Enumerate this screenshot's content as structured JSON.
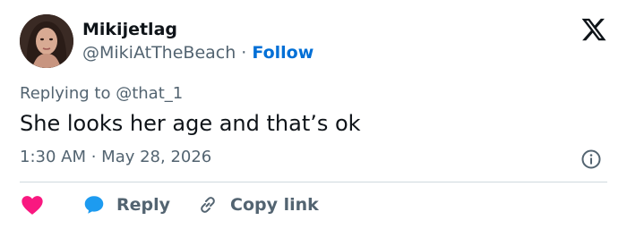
{
  "author": {
    "display_name": "Mikijetlag",
    "handle": "@MikiAtTheBeach",
    "separator": " · ",
    "follow_label": "Follow"
  },
  "tweet": {
    "replying_to": "Replying to @that_1",
    "text": "She looks her age and that’s ok",
    "time": "1:30 AM",
    "date_separator": " · ",
    "date": "May 28, 2026"
  },
  "actions": {
    "reply_label": "Reply",
    "copy_link_label": "Copy link"
  },
  "icons": {
    "logo": "x-logo-icon",
    "info": "info-icon",
    "like": "heart-icon",
    "reply": "speech-bubble-icon",
    "copy_link": "link-icon"
  },
  "colors": {
    "text_primary": "#0f1419",
    "text_secondary": "#536471",
    "follow_blue": "#006fd6",
    "heart_red": "#f91880",
    "reply_blue": "#1d9bf0",
    "divider": "#cfd9de"
  }
}
